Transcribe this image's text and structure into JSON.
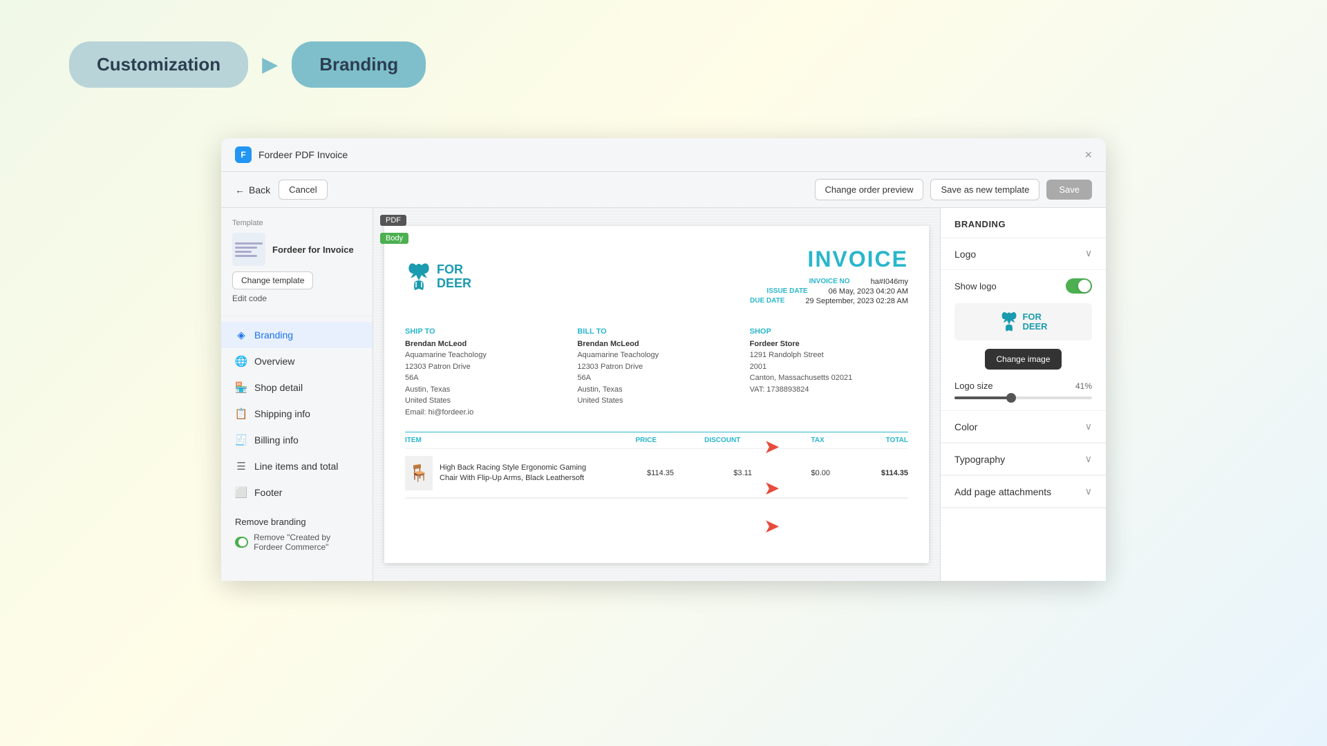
{
  "topNav": {
    "step1": "Customization",
    "step2": "Branding"
  },
  "window": {
    "title": "Fordeer PDF Invoice",
    "closeLabel": "×"
  },
  "toolbar": {
    "backLabel": "Back",
    "cancelLabel": "Cancel",
    "changeOrderLabel": "Change order preview",
    "saveTemplateLabel": "Save as new template",
    "saveLabel": "Save"
  },
  "sidebar": {
    "templateLabel": "Template",
    "templateName": "Fordeer for Invoice",
    "changeTemplateBtn": "Change template",
    "editCodeLink": "Edit code",
    "navItems": [
      {
        "id": "branding",
        "label": "Branding",
        "icon": "◈"
      },
      {
        "id": "overview",
        "label": "Overview",
        "icon": "🌐"
      },
      {
        "id": "shop-detail",
        "label": "Shop detail",
        "icon": "🏪"
      },
      {
        "id": "shipping-info",
        "label": "Shipping info",
        "icon": "📋"
      },
      {
        "id": "billing-info",
        "label": "Billing info",
        "icon": "🧾"
      },
      {
        "id": "line-items",
        "label": "Line items and total",
        "icon": "☰"
      },
      {
        "id": "footer",
        "label": "Footer",
        "icon": "⬜"
      }
    ],
    "removeBranding": "Remove branding",
    "removeBrandingToggle": "Remove \"Created by Fordeer Commerce\""
  },
  "invoice": {
    "pdfBadge": "PDF",
    "bodyBadge": "Body",
    "title": "INVOICE",
    "logoText1": "FOR",
    "logoText2": "DEER",
    "fields": {
      "invoiceNo": "INVOICE NO",
      "issueDate": "ISSUE DATE",
      "dueDate": "DUE DATE",
      "invoiceNoValue": "ha#I046my",
      "issueDateValue": "06 May, 2023 04:20 AM",
      "dueDateValue": "29 September, 2023 02:28 AM"
    },
    "shipTo": {
      "label": "SHIP TO",
      "name": "Brendan McLeod",
      "company": "Aquamarine Teachology",
      "address1": "12303 Patron Drive",
      "address2": "56A",
      "city": "Austin, Texas",
      "country": "United States",
      "email": "Email: hi@fordeer.io"
    },
    "billTo": {
      "label": "BILL TO",
      "name": "Brendan McLeod",
      "company": "Aquamarine Teachology",
      "address1": "12303 Patron Drive",
      "address2": "56A",
      "city": "Austin, Texas",
      "country": "United States"
    },
    "shop": {
      "label": "SHOP",
      "name": "Fordeer Store",
      "address1": "1291 Randolph Street",
      "address2": "2001",
      "city": "Canton, Massachusetts 02021",
      "vat": "VAT: 1738893824"
    },
    "tableHeaders": {
      "item": "ITEM",
      "price": "PRICE",
      "discount": "DISCOUNT",
      "tax": "TAX",
      "total": "TOTAL"
    },
    "lineItem": {
      "name": "High Back Racing Style Ergonomic Gaming Chair With Flip-Up Arms, Black Leathersoft",
      "price": "$114.35",
      "discount": "$3.11",
      "tax": "$0.00",
      "total": "$114.35"
    }
  },
  "branding": {
    "title": "BRANDING",
    "logoSection": "Logo",
    "showLogoLabel": "Show logo",
    "logoSizeLabel": "Logo size",
    "logoSizeValue": "41%",
    "changeImageBtn": "Change image",
    "colorSection": "Color",
    "typographySection": "Typography",
    "addAttachmentsSection": "Add page attachments"
  }
}
